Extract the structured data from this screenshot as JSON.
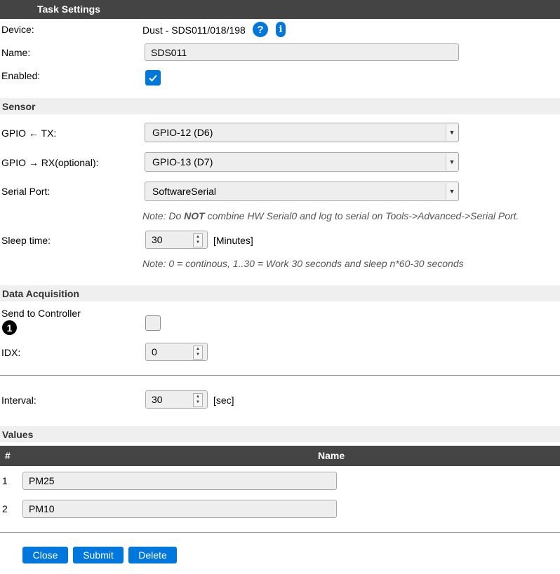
{
  "header": {
    "title": "Task Settings"
  },
  "device": {
    "label": "Device:",
    "value": "Dust - SDS011/018/198",
    "help_icon": "question-circle-icon",
    "info_icon": "info-icon"
  },
  "name_field": {
    "label": "Name:",
    "value": "SDS011"
  },
  "enabled": {
    "label": "Enabled:",
    "checked": true
  },
  "sensor": {
    "title": "Sensor",
    "gpio_tx": {
      "label": "GPIO ← TX:",
      "value": "GPIO-12 (D6)"
    },
    "gpio_rx": {
      "label": "GPIO → RX(optional):",
      "value": "GPIO-13 (D7)"
    },
    "serial_port": {
      "label": "Serial Port:",
      "value": "SoftwareSerial"
    },
    "note_serial": {
      "pre": "Note: Do ",
      "bold": "NOT",
      "post": " combine HW Serial0 and log to serial on Tools->Advanced->Serial Port."
    },
    "sleep_time": {
      "label": "Sleep time:",
      "value": "30",
      "unit": "[Minutes]"
    },
    "note_sleep": "Note: 0 = continous, 1..30 = Work 30 seconds and sleep n*60-30 seconds"
  },
  "data_acquisition": {
    "title": "Data Acquisition",
    "send_to_controller": {
      "label": "Send to Controller",
      "badge": "1",
      "checked": false
    },
    "idx": {
      "label": "IDX:",
      "value": "0"
    },
    "interval": {
      "label": "Interval:",
      "value": "30",
      "unit": "[sec]"
    }
  },
  "values": {
    "title": "Values",
    "columns": {
      "num": "#",
      "name": "Name"
    },
    "rows": [
      {
        "num": "1",
        "name": "PM25"
      },
      {
        "num": "2",
        "name": "PM10"
      }
    ]
  },
  "buttons": {
    "close": "Close",
    "submit": "Submit",
    "delete": "Delete"
  },
  "colors": {
    "header_bg": "#444444",
    "section_bg": "#efefef",
    "accent": "#0077dd"
  }
}
